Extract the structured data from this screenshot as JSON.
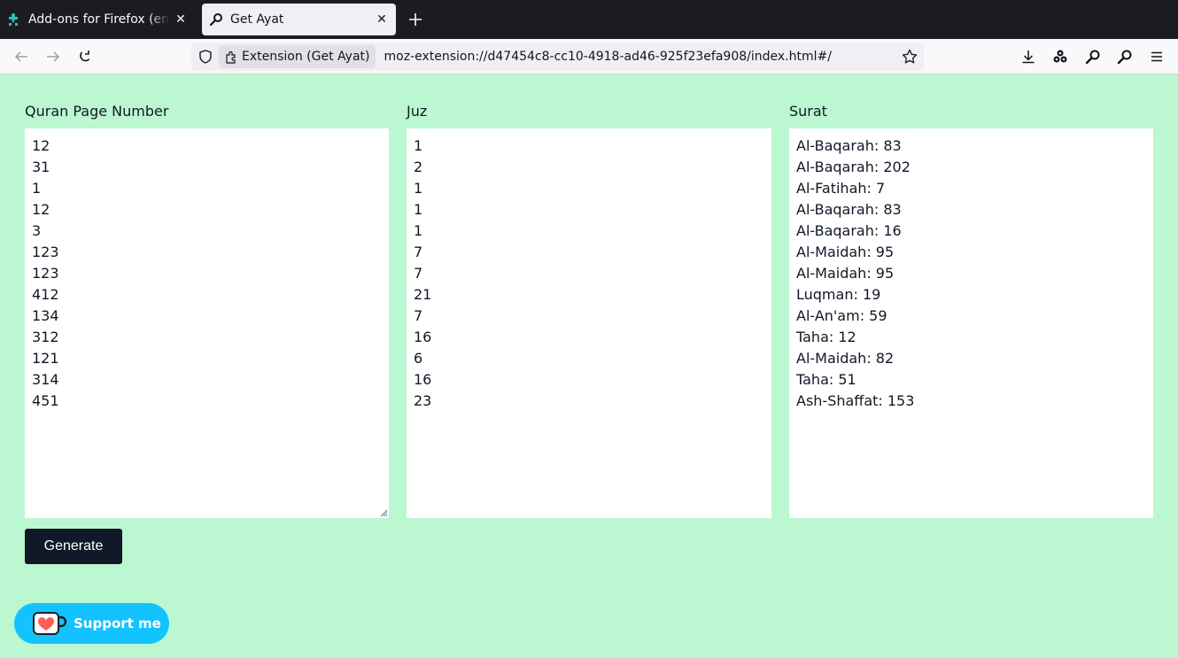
{
  "browser": {
    "tabs": [
      {
        "title": "Add-ons for Firefox (en-US)",
        "active": false,
        "icon": "puzzle-addons-icon"
      },
      {
        "title": "Get Ayat",
        "active": true,
        "icon": "search-icon"
      }
    ],
    "identity_label": "Extension (Get Ayat)",
    "url": "moz-extension://d47454c8-cc10-4918-ad46-925f23efa908/index.html#/"
  },
  "page": {
    "background": "#bbf7d0",
    "page_label": "Quran Page Number",
    "juz_label": "Juz",
    "surat_label": "Surat",
    "page_numbers": [
      "12",
      "31",
      "1",
      "12",
      "3",
      "123",
      "123",
      "412",
      "134",
      "312",
      "121",
      "314",
      "451"
    ],
    "juz_values": [
      "1",
      "2",
      "1",
      "1",
      "1",
      "7",
      "7",
      "21",
      "7",
      "16",
      "6",
      "16",
      "23"
    ],
    "surat_values": [
      "Al-Baqarah: 83",
      "Al-Baqarah: 202",
      "Al-Fatihah: 7",
      "Al-Baqarah: 83",
      "Al-Baqarah: 16",
      "Al-Maidah: 95",
      "Al-Maidah: 95",
      "Luqman: 19",
      "Al-An'am: 59",
      "Taha: 12",
      "Al-Maidah: 82",
      "Taha: 51",
      "Ash-Shaffat: 153"
    ],
    "generate_label": "Generate",
    "support_label": "Support me",
    "accent": "#111827",
    "support_color": "#13c3ff"
  }
}
